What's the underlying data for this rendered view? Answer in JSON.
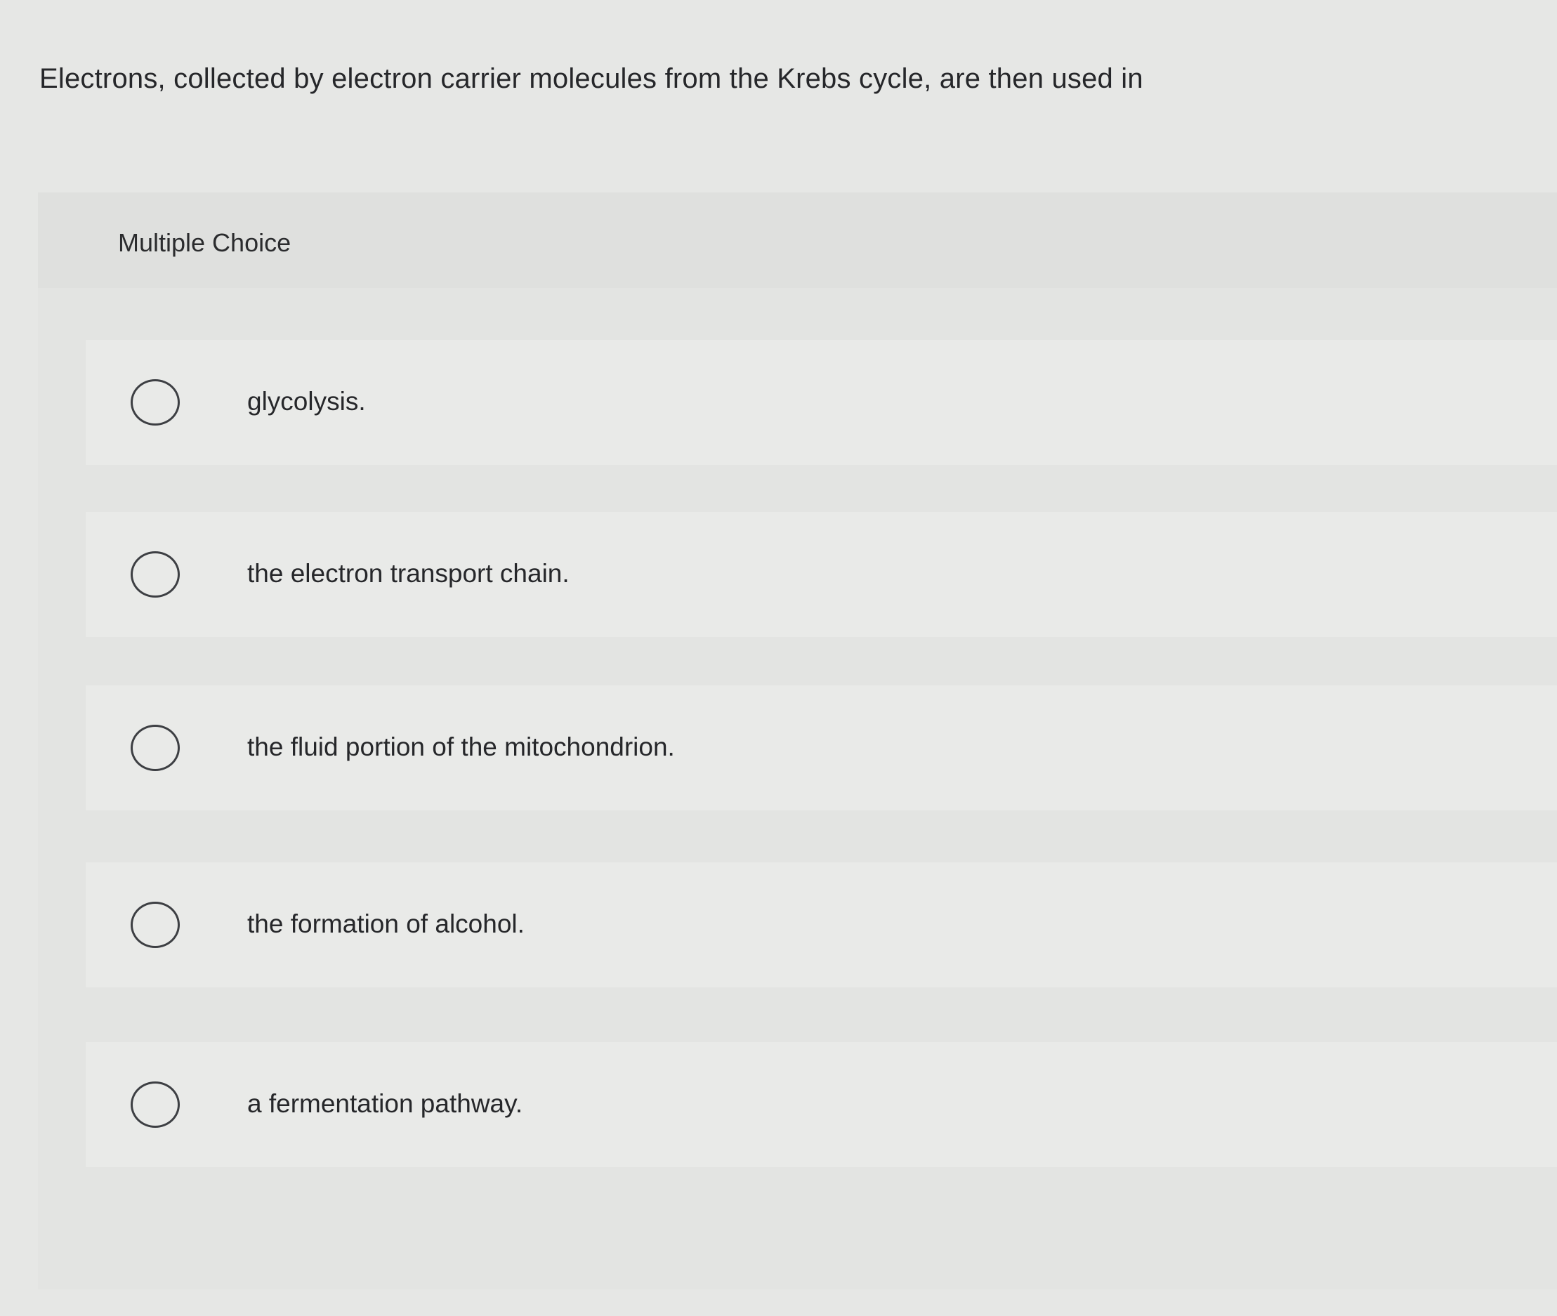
{
  "question": {
    "text": "Electrons, collected by electron carrier molecules from the Krebs cycle, are then used in"
  },
  "section": {
    "label": "Multiple Choice"
  },
  "choices": [
    {
      "label": "glycolysis.",
      "selected": false
    },
    {
      "label": "the electron transport chain.",
      "selected": false
    },
    {
      "label": "the fluid portion of the mitochondrion.",
      "selected": false
    },
    {
      "label": "the formation of alcohol.",
      "selected": false
    },
    {
      "label": "a fermentation pathway.",
      "selected": false
    }
  ],
  "colors": {
    "background": "#e6e7e5",
    "text": "#26272a",
    "radio_border": "#3d3f43"
  }
}
